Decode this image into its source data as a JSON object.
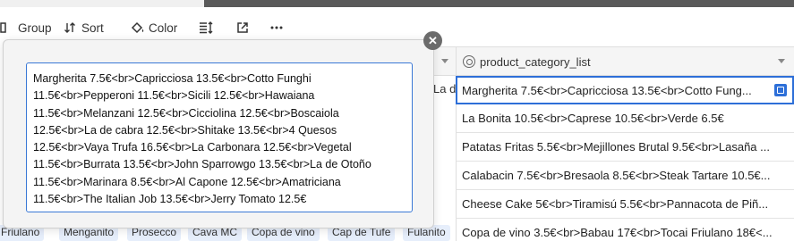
{
  "toolbar": {
    "group_label": "Group",
    "sort_label": "Sort",
    "color_label": "Color"
  },
  "column": {
    "name": "product_category_list"
  },
  "popup": {
    "text": "Margherita 7.5€<br>Capricciosa 13.5€<br>Cotto Funghi 11.5€<br>Pepperoni 11.5€<br>Sicili 12.5€<br>Hawaiana 11.5€<br>Melanzani 12.5€<br>Cicciolina 12.5€<br>Boscaiola 12.5€<br>La de cabra 12.5€<br>Shitake 13.5€<br>4 Quesos 12.5€<br>Vaya Trufa 16.5€<br>La Carbonara 12.5€<br>Vegetal 11.5€<br>Burrata 13.5€<br>John Sparrowgo 13.5€<br>La de Otoño 11.5€<br>Marinara 8.5€<br>Al Capone 12.5€<br>Amatriciana 11.5€<br>The Italian Job 13.5€<br>Jerry Tomato 12.5€"
  },
  "left_partial": "La d",
  "rows": [
    "Margherita 7.5€<br>Capricciosa 13.5€<br>Cotto Fung...",
    "La Bonita 10.5€<br>Caprese 10.5€<br>Verde 6.5€",
    "Patatas Fritas 5.5€<br>Mejillones Brutal 9.5€<br>Lasaña ...",
    "Calabacin 7.5€<br>Bresaola 8.5€<br>Steak Tartare 10.5€...",
    "Cheese Cake 5€<br>Tiramisú 5.5€<br>Pannacota de Piñ...",
    "Copa de vino 3.5€<br>Babau 17€<br>Tocai Friulano 18€<..."
  ],
  "chips": [
    "Friulano",
    "Menganito",
    "Prosecco",
    "Cava MC",
    "Copa de vino",
    "Cap de Tufe",
    "Fulanito"
  ]
}
